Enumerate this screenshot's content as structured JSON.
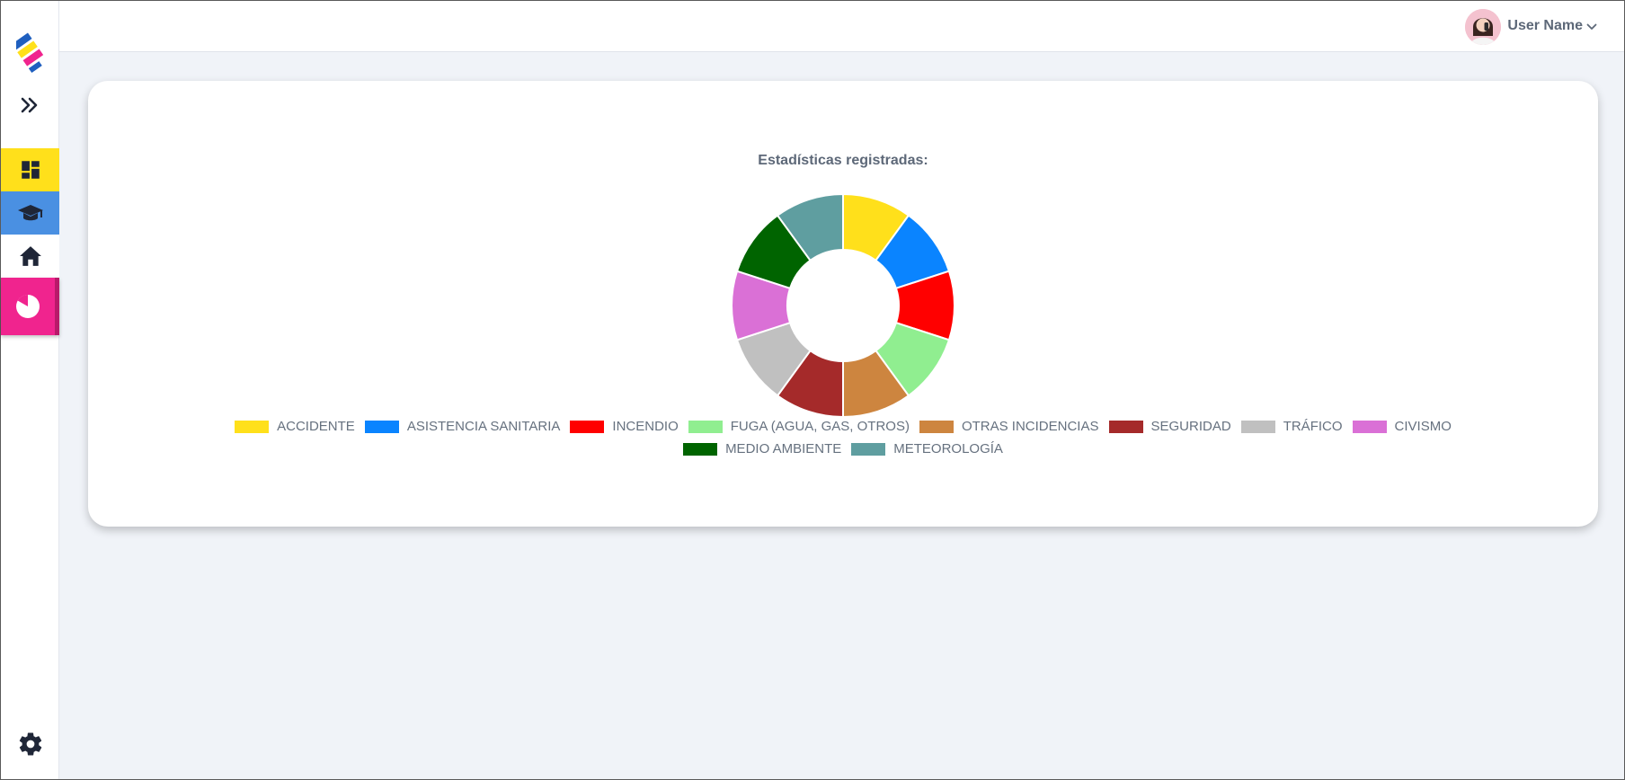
{
  "header": {
    "user_name": "User Name"
  },
  "sidebar": {
    "items": [
      {
        "icon": "dashboard-icon",
        "color": "#ffe01b"
      },
      {
        "icon": "graduation-cap-icon",
        "color": "#4a90e2"
      },
      {
        "icon": "home-icon",
        "color": "#ffffff"
      },
      {
        "icon": "pie-chart-icon",
        "color": "#f0248e"
      }
    ]
  },
  "chart": {
    "title": "Estadísticas registradas:"
  },
  "chart_data": {
    "type": "pie",
    "title": "Estadísticas registradas:",
    "legend_position": "bottom",
    "categories": [
      "ACCIDENTE",
      "ASISTENCIA SANITARIA",
      "INCENDIO",
      "FUGA (AGUA, GAS, OTROS)",
      "OTRAS INCIDENCIAS",
      "SEGURIDAD",
      "TRÁFICO",
      "CIVISMO",
      "MEDIO AMBIENTE",
      "METEOROLOGÍA"
    ],
    "values": [
      1,
      1,
      1,
      1,
      1,
      1,
      1,
      1,
      1,
      1
    ],
    "colors": [
      "#ffe01b",
      "#0a84ff",
      "#ff0000",
      "#90ee90",
      "#cd853f",
      "#a52a2a",
      "#c0c0c0",
      "#da70d6",
      "#006400",
      "#5f9ea0"
    ]
  }
}
